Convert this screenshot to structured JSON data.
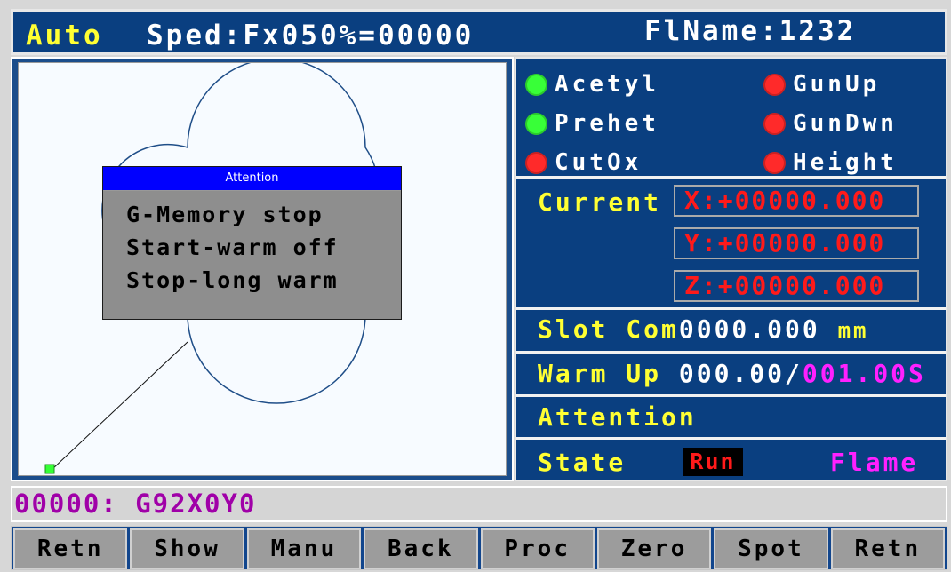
{
  "header": {
    "mode": "Auto",
    "speed": "Sped:Fx050%=00000",
    "filename": "FlName:1232"
  },
  "attention_dialog": {
    "title": "Attention",
    "lines": [
      "G-Memory stop",
      "Start-warm off",
      "Stop-long warm"
    ]
  },
  "status": {
    "items": [
      {
        "label": "Acetyl",
        "state": "green",
        "icon": "status-led-icon"
      },
      {
        "label": "GunUp",
        "state": "red",
        "icon": "status-led-icon"
      },
      {
        "label": "Prehet",
        "state": "green",
        "icon": "status-led-icon"
      },
      {
        "label": "GunDwn",
        "state": "red",
        "icon": "status-led-icon"
      },
      {
        "label": "CutOx",
        "state": "red",
        "icon": "status-led-icon"
      },
      {
        "label": "Height",
        "state": "red",
        "icon": "status-led-icon"
      }
    ]
  },
  "coordinates": {
    "label": "Current",
    "x": "X:+00000.000",
    "y": "Y:+00000.000",
    "z": "Z:+00000.000"
  },
  "slot_comp": {
    "label": "Slot Com",
    "value": "0000.000",
    "unit": "mm"
  },
  "warm_up": {
    "label": "Warm Up",
    "current": "000.00/",
    "total": "001.00S"
  },
  "attention": {
    "label": "Attention"
  },
  "state": {
    "label": "State",
    "run": "Run",
    "mode": "Flame"
  },
  "program_line": "00000: G92X0Y0",
  "function_buttons": [
    "Retn",
    "Show",
    "Manu",
    "Back",
    "Proc",
    "Zero",
    "Spot",
    "Retn"
  ],
  "colors": {
    "panel_blue": "#0a3f80",
    "header_yellow": "#ffff33",
    "coordinate_red": "#ff1a1a",
    "accent_magenta": "#ff20ff",
    "dialog_title_blue": "#0000ff"
  }
}
